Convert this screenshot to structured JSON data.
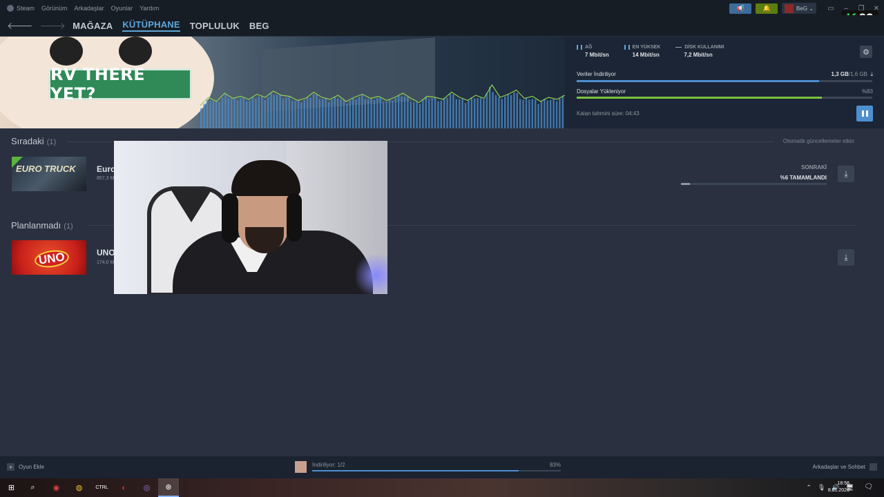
{
  "menubar": {
    "items": [
      "Steam",
      "Görünüm",
      "Arkadaşlar",
      "Oyunlar",
      "Yardım"
    ]
  },
  "user": {
    "name": "BeG"
  },
  "overlay_badge": {
    "k": "K",
    "num": "29"
  },
  "nav": {
    "tabs": [
      "MAĞAZA",
      "KÜTÜPHANE",
      "TOPLULUK",
      "BEG"
    ],
    "active": "KÜTÜPHANE"
  },
  "banner": {
    "title": "RV THERE YET?"
  },
  "stats": {
    "network": {
      "label": "AĞ",
      "value": "7 Mbit/sn"
    },
    "peak": {
      "label": "EN YÜKSEK",
      "value": "14 Mbit/sn"
    },
    "disk": {
      "label": "DİSK KULLANIMI",
      "value": "7,2 Mbit/sn"
    }
  },
  "progress": {
    "downloading_label": "Veriler İndiriliyor",
    "downloaded": "1,3 GB",
    "total": "/1,6 GB",
    "downloading_fraction": 0.82,
    "installing_label": "Dosyalar Yükleniyor",
    "installing_pct": "%83",
    "installing_fraction": 0.83,
    "eta": "Kalan tahmini süre: 04:43"
  },
  "queue": {
    "title": "Sıradaki",
    "count": "(1)",
    "auto_update": "Otomatik güncellemeler etkin",
    "item": {
      "name": "Euro",
      "size": "857,3 M",
      "thumb_text": "EURO TRUCK",
      "next_label": "SONRAKİ",
      "complete": "%6 TAMAMLANDI",
      "fraction": 0.06
    }
  },
  "unscheduled": {
    "title": "Planlanmadı",
    "count": "(1)",
    "item": {
      "name": "UNO",
      "size": "174,0 M",
      "thumb_text": "UNO"
    }
  },
  "bottombar": {
    "add_game": "Oyun Ekle",
    "downloading": "İndiriliyor: 1/2",
    "pct": "83%",
    "fraction": 0.83,
    "friends": "Arkadaşlar ve Sohbet"
  },
  "taskbar": {
    "time": "18:56",
    "date": "8.01.2026"
  },
  "graph_series": [
    22,
    30,
    26,
    34,
    29,
    31,
    28,
    33,
    30,
    36,
    32,
    31,
    27,
    29,
    35,
    30,
    28,
    32,
    26,
    30,
    33,
    29,
    31,
    27,
    30,
    34,
    29,
    25,
    31,
    30,
    28,
    35,
    30,
    27,
    32,
    29,
    42,
    30,
    33,
    37,
    29,
    31,
    26,
    30,
    28,
    32
  ],
  "colors": {
    "accent_blue": "#4e8fd0",
    "install_green": "#7ec23c",
    "graph_line": "#8fd14f"
  }
}
